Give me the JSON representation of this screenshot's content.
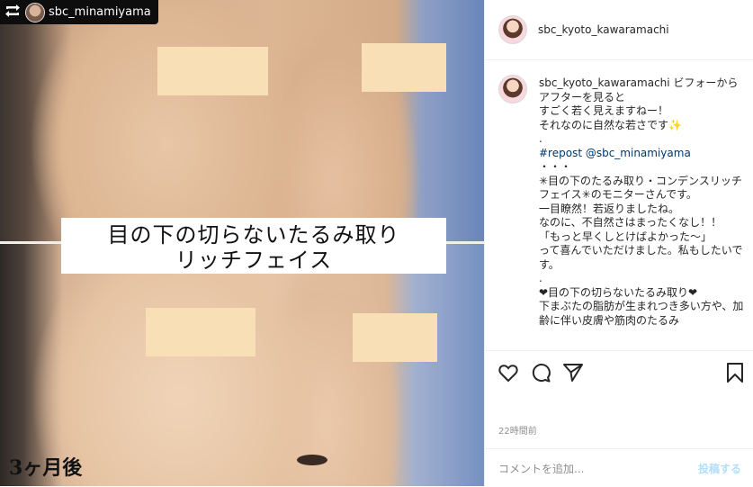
{
  "repost_header": {
    "username": "sbc_minamiyama"
  },
  "photo": {
    "caption_line1": "目の下の切らないたるみ取り",
    "caption_line2": "リッチフェイス",
    "after_label": "3ヶ月後"
  },
  "post_header": {
    "username": "sbc_kyoto_kawaramachi"
  },
  "comment": {
    "username": "sbc_kyoto_kawaramachi",
    "text_1": " ビフォーからアフターを見ると\nすごく若く見えますねー！\nそれなのに自然な若さです",
    "sparkle": "✨",
    "text_dot1": "\n.\n",
    "repost_tag": "#repost @sbc_minamiyama",
    "text_2": "\n・・・\n✳︎目の下のたるみ取り・コンデンスリッチフェイス✳︎のモニターさんです。\n一目瞭然！若返りましたね。\nなのに、不自然さはまったくなし！！\n「もっと早くしとけばよかった〜」\nって喜んでいただけました。私もしたいです。\n.\n❤目の下の切らないたるみ取り❤\n下まぶたの脂肪が生まれつき多い方や、加齢に伴い皮膚や筋肉のたるみ"
  },
  "timestamp": "22時間前",
  "comment_box": {
    "placeholder": "コメントを追加...",
    "post_label": "投稿する"
  },
  "icons": {
    "repost": "repost-icon",
    "like": "heart-icon",
    "comment": "comment-icon",
    "share": "share-icon",
    "save": "bookmark-icon"
  },
  "colors": {
    "link": "#00376b",
    "post_button": "#b2dffc",
    "muted": "#8e8e8e"
  }
}
